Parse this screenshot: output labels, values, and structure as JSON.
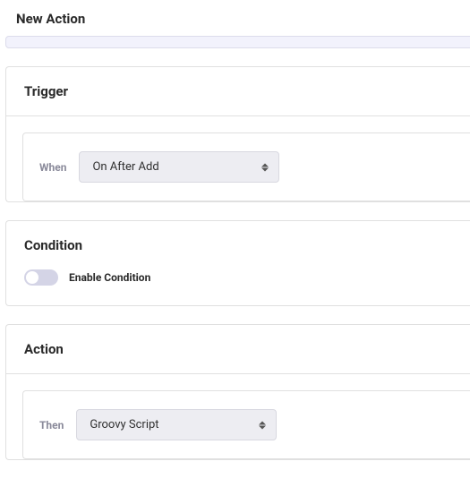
{
  "page": {
    "title": "New Action"
  },
  "trigger": {
    "heading": "Trigger",
    "when_label": "When",
    "when_value": "On After Add"
  },
  "condition": {
    "heading": "Condition",
    "toggle_label": "Enable Condition",
    "toggle_on": false
  },
  "action": {
    "heading": "Action",
    "then_label": "Then",
    "then_value": "Groovy Script"
  }
}
